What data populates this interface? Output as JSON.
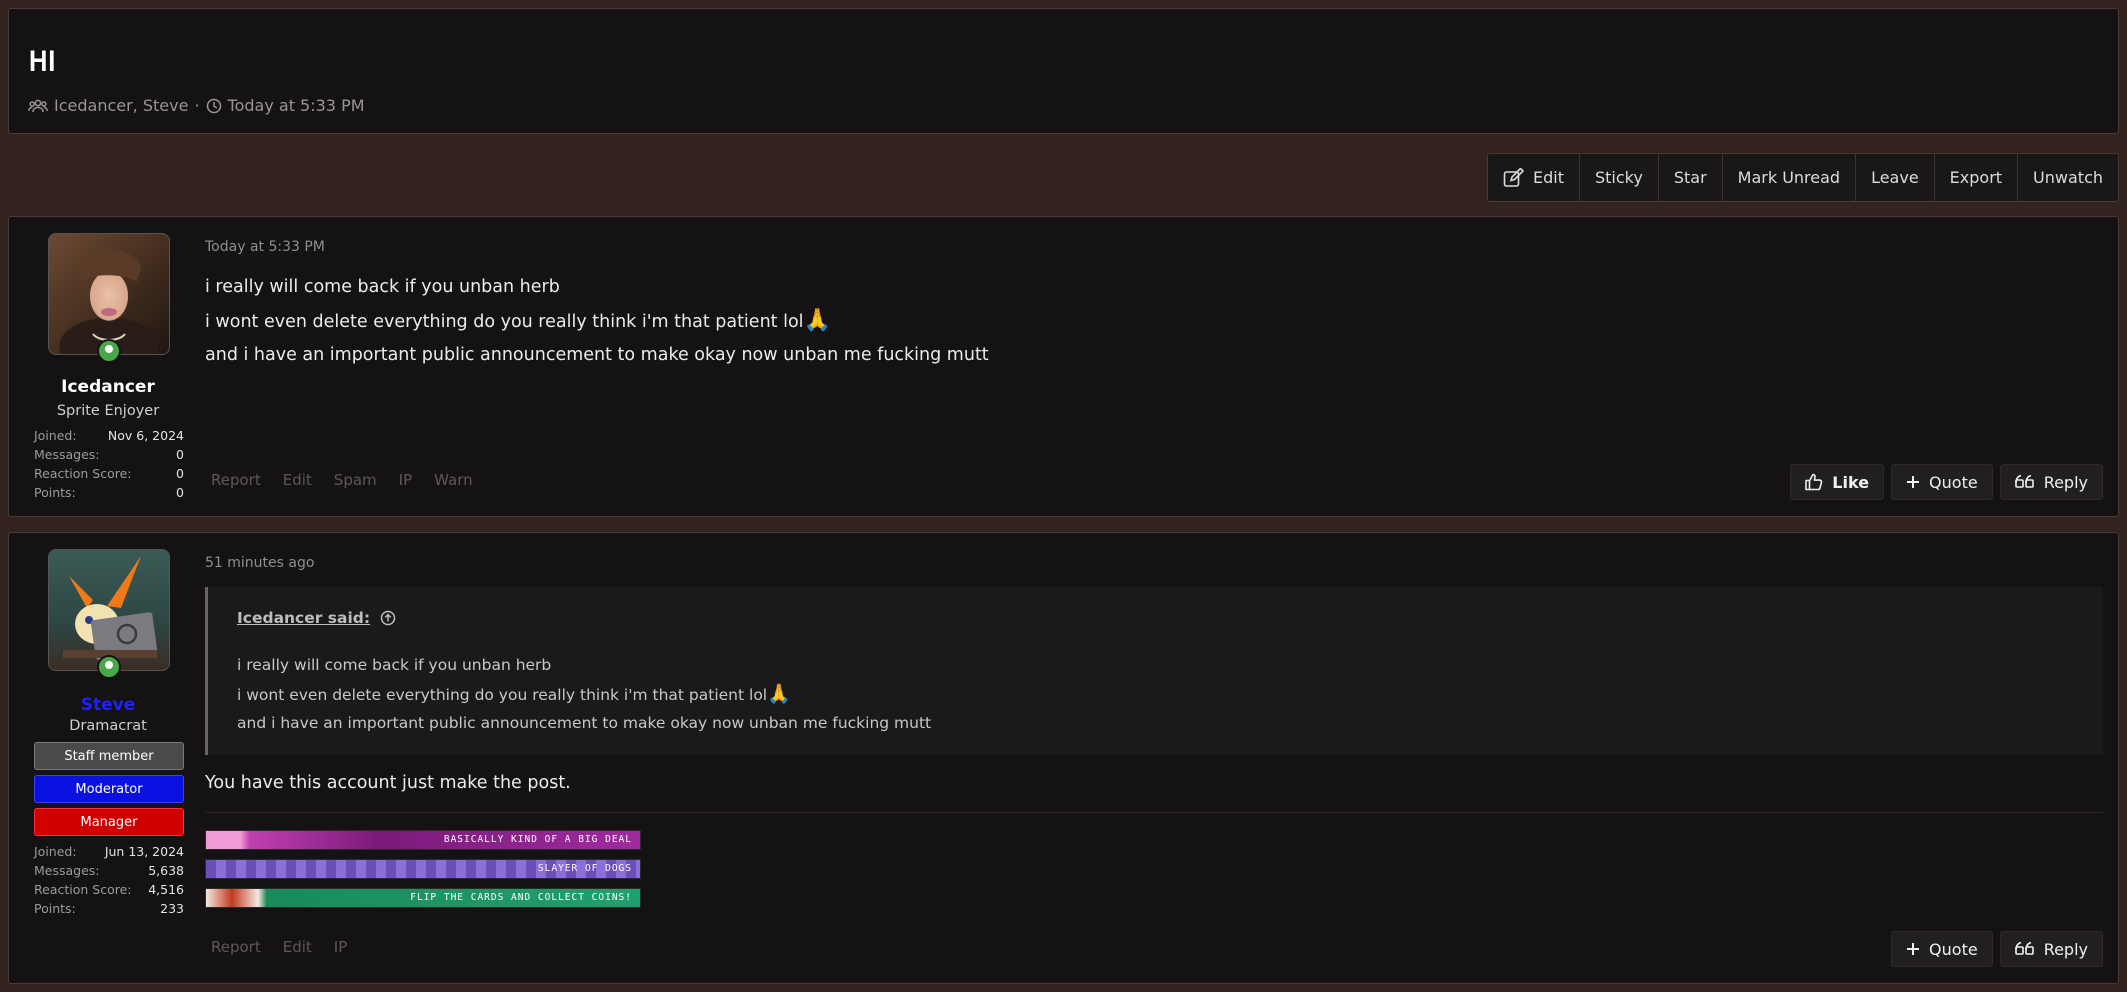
{
  "thread": {
    "title": "HI",
    "participants": "Icedancer, Steve",
    "separator": "·",
    "time": "Today at 5:33 PM"
  },
  "toolbar": {
    "buttons": [
      {
        "label": "Edit",
        "icon": "edit-icon"
      },
      {
        "label": "Sticky"
      },
      {
        "label": "Star"
      },
      {
        "label": "Mark Unread"
      },
      {
        "label": "Leave"
      },
      {
        "label": "Export"
      },
      {
        "label": "Unwatch"
      }
    ]
  },
  "posts": [
    {
      "user": {
        "name": "Icedancer",
        "title": "Sprite Enjoyer",
        "name_color": "#ffffff",
        "stats": [
          {
            "label": "Joined:",
            "value": "Nov 6, 2024"
          },
          {
            "label": "Messages:",
            "value": "0"
          },
          {
            "label": "Reaction Score:",
            "value": "0"
          },
          {
            "label": "Points:",
            "value": "0"
          }
        ]
      },
      "date": "Today at 5:33 PM",
      "lines": [
        "i really will come back if you unban herb",
        "i wont even delete everything do you really think i'm that patient lol",
        "and i have an important public announcement to make okay now unban me fucking mutt"
      ],
      "emoji": "🙏",
      "links": [
        "Report",
        "Edit",
        "Spam",
        "IP",
        "Warn"
      ],
      "actions": [
        "Like",
        "Quote",
        "Reply"
      ]
    },
    {
      "user": {
        "name": "Steve",
        "title": "Dramacrat",
        "name_color": "#2020ff",
        "badges": [
          {
            "label": "Staff member",
            "bg": "#4a4a4a",
            "border": "#7a7a7a"
          },
          {
            "label": "Moderator",
            "bg": "#0a10e0",
            "border": "#3a40ff"
          },
          {
            "label": "Manager",
            "bg": "#d10000",
            "border": "#ff3030"
          }
        ],
        "stats": [
          {
            "label": "Joined:",
            "value": "Jun 13, 2024"
          },
          {
            "label": "Messages:",
            "value": "5,638"
          },
          {
            "label": "Reaction Score:",
            "value": "4,516"
          },
          {
            "label": "Points:",
            "value": "233"
          }
        ]
      },
      "date": "51 minutes ago",
      "quote": {
        "author": "Icedancer said:",
        "lines": [
          "i really will come back if you unban herb",
          "i wont even delete everything do you really think i'm that patient lol",
          "and i have an important public announcement to make okay now unban me fucking mutt"
        ]
      },
      "body": "You have this account just make the post.",
      "signature": [
        "Basically kind of a big deal",
        "Slayer of dogs",
        "Flip the cards and collect coins!"
      ],
      "links": [
        "Report",
        "Edit",
        "IP"
      ],
      "actions": [
        "Quote",
        "Reply"
      ]
    }
  ]
}
